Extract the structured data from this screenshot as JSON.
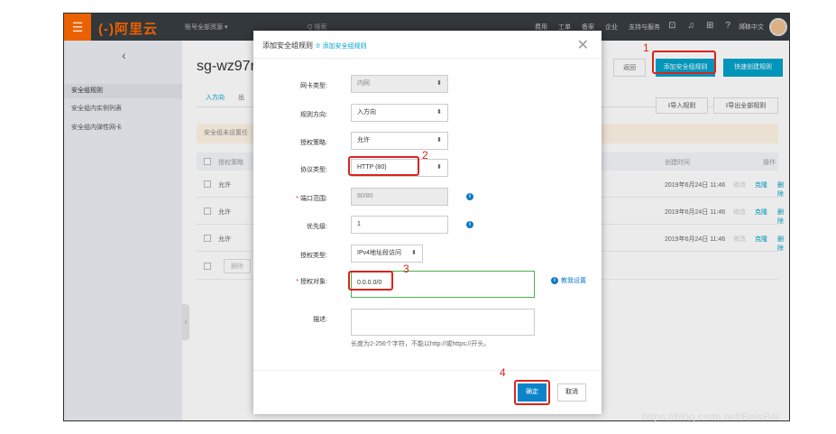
{
  "topbar": {
    "menu_icon": "☰",
    "logo": "(-)阿里云",
    "account": "账号全部资源 ▾",
    "search_placeholder": "Q 搜索",
    "nav": [
      "费用",
      "工单",
      "备案",
      "企业",
      "支持与服务"
    ],
    "language": "简体中文"
  },
  "sidebar": {
    "back_icon": "‹",
    "items": [
      "安全组规则",
      "安全组内实例列表",
      "安全组内弹性网卡"
    ]
  },
  "main": {
    "title": "sg-wz97r",
    "back_label": "返回",
    "add_rule_label": "添加安全组规则",
    "quick_rule_label": "快速创建规则",
    "tabs": [
      "入方向",
      "出"
    ],
    "import_label": "⭱导入规则",
    "export_label": "⭱导出全部规则",
    "notice": "安全组未设置任",
    "table_headers": [
      "授权策略",
      "创建时间",
      "操作"
    ],
    "rows": [
      {
        "policy": "允许",
        "time": "2019年6月24日 11:46",
        "edit": "修改",
        "clone": "克隆",
        "delete": "删除"
      },
      {
        "policy": "允许",
        "time": "2019年6月24日 11:46",
        "edit": "修改",
        "clone": "克隆",
        "delete": "删除"
      },
      {
        "policy": "允许",
        "time": "2019年6月24日 11:46",
        "edit": "修改",
        "clone": "克隆",
        "delete": "删除"
      }
    ],
    "batch_delete": "删除"
  },
  "modal": {
    "title": "添加安全组规则",
    "help": "⑦ 添加安全组规则",
    "close": "✕",
    "fields": {
      "nic_type": {
        "label": "网卡类型:",
        "value": "内网"
      },
      "direction": {
        "label": "规则方向:",
        "value": "入方向"
      },
      "policy": {
        "label": "授权策略:",
        "value": "允许"
      },
      "protocol": {
        "label": "协议类型:",
        "value": "HTTP (80)"
      },
      "port_range": {
        "label": "端口范围:",
        "value": "80/80"
      },
      "priority": {
        "label": "优先级:",
        "value": "1"
      },
      "auth_type": {
        "label": "授权类型:",
        "value": "IPv4地址段访问"
      },
      "auth_object": {
        "label": "授权对象:",
        "value": "0.0.0.0/0"
      },
      "description": {
        "label": "描述:",
        "value": ""
      }
    },
    "teach_label": "教我设置",
    "description_hint": "长度为2-256个字符，不能以http://或https://开头。",
    "ok_label": "确定",
    "cancel_label": "取消"
  },
  "annotations": [
    "1",
    "2",
    "3",
    "4"
  ],
  "watermark": "https://blog.csdn.net/BeisBei",
  "colors": {
    "accent": "#00a2ca",
    "brand": "#ff6a00",
    "highlight": "#d9241d",
    "primary_button": "#0d84c9"
  }
}
